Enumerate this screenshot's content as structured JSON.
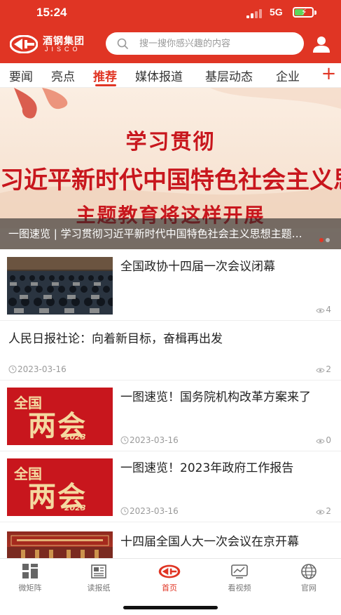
{
  "status_bar": {
    "time": "15:24",
    "network": "5G"
  },
  "header": {
    "logo_name": "酒钢集团",
    "logo_sub": "JISCO",
    "search_placeholder": "搜一搜你感兴趣的内容"
  },
  "tabs": [
    {
      "label": "要闻"
    },
    {
      "label": "亮点"
    },
    {
      "label": "推荐",
      "active": true
    },
    {
      "label": "媒体报道"
    },
    {
      "label": "基层动态"
    },
    {
      "label": "企业"
    }
  ],
  "tabs_add": "+",
  "banner": {
    "line1": "学习贯彻",
    "line2": "习近平新时代中国特色社会主义思想",
    "line3": "主题教育将这样开展",
    "caption": "一图速览 | 学习贯彻习近平新时代中国特色社会主义思想主题教育将这样开展"
  },
  "news": [
    {
      "title": "全国政协十四届一次会议闭幕",
      "date": "",
      "views": "4"
    },
    {
      "title": "人民日报社论：向着新目标，奋楫再出发",
      "date": "2023-03-16",
      "views": "2"
    },
    {
      "title": "一图速览！国务院机构改革方案来了",
      "date": "2023-03-16",
      "views": "0",
      "thumb": {
        "top": "全国",
        "big": "两会",
        "year": "2023"
      }
    },
    {
      "title": "一图速览！2023年政府工作报告",
      "date": "2023-03-16",
      "views": "2",
      "thumb": {
        "top": "全国",
        "big": "两会",
        "year": "2023"
      }
    },
    {
      "title": "十四届全国人大一次会议在京开幕",
      "date": "",
      "views": ""
    }
  ],
  "bottom_nav": [
    {
      "label": "微矩阵",
      "icon": "grid-icon"
    },
    {
      "label": "读报纸",
      "icon": "newspaper-icon"
    },
    {
      "label": "首页",
      "icon": "home-logo-icon",
      "active": true
    },
    {
      "label": "看视频",
      "icon": "video-icon"
    },
    {
      "label": "官网",
      "icon": "globe-icon"
    }
  ],
  "colors": {
    "brand_red": "#e03524",
    "text": "#222222",
    "meta": "#9a9a9a"
  }
}
